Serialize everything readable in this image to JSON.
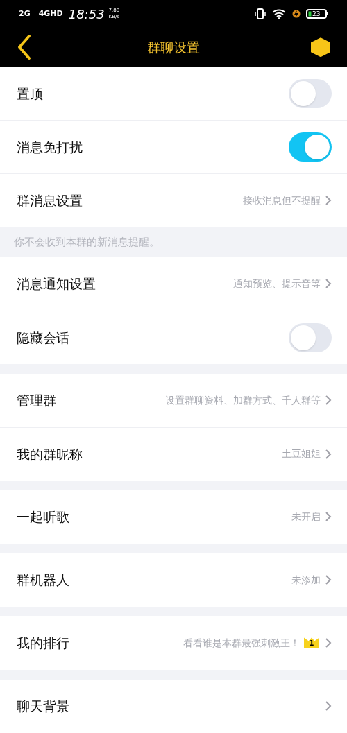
{
  "status_bar": {
    "network_1": "2G",
    "network_2": "4GHD",
    "time": "18:53",
    "speed": "7.80",
    "speed_unit": "KB/s",
    "battery": "23"
  },
  "header": {
    "title": "群聊设置"
  },
  "sections": [
    {
      "kind": "group",
      "items": [
        {
          "kind": "toggle",
          "label": "置顶",
          "on": false
        },
        {
          "kind": "toggle",
          "label": "消息免打扰",
          "on": true
        },
        {
          "kind": "link",
          "label": "群消息设置",
          "value": "接收消息但不提醒"
        }
      ]
    },
    {
      "kind": "note",
      "text": "你不会收到本群的新消息提醒。"
    },
    {
      "kind": "group",
      "items": [
        {
          "kind": "link",
          "label": "消息通知设置",
          "value": "通知预览、提示音等"
        },
        {
          "kind": "toggle",
          "label": "隐藏会话",
          "on": false
        }
      ]
    },
    {
      "kind": "group",
      "items": [
        {
          "kind": "link",
          "label": "管理群",
          "value": "设置群聊资料、加群方式、千人群等"
        },
        {
          "kind": "link",
          "label": "我的群昵称",
          "value": "土豆姐姐"
        }
      ]
    },
    {
      "kind": "group",
      "items": [
        {
          "kind": "link",
          "label": "一起听歌",
          "value": "未开启"
        }
      ]
    },
    {
      "kind": "group",
      "items": [
        {
          "kind": "link",
          "label": "群机器人",
          "value": "未添加"
        }
      ]
    },
    {
      "kind": "group",
      "items": [
        {
          "kind": "link",
          "label": "我的排行",
          "value": "看看谁是本群最强刺激王！",
          "badge": "1"
        }
      ]
    },
    {
      "kind": "group",
      "items": [
        {
          "kind": "link",
          "label": "聊天背景"
        }
      ]
    }
  ]
}
